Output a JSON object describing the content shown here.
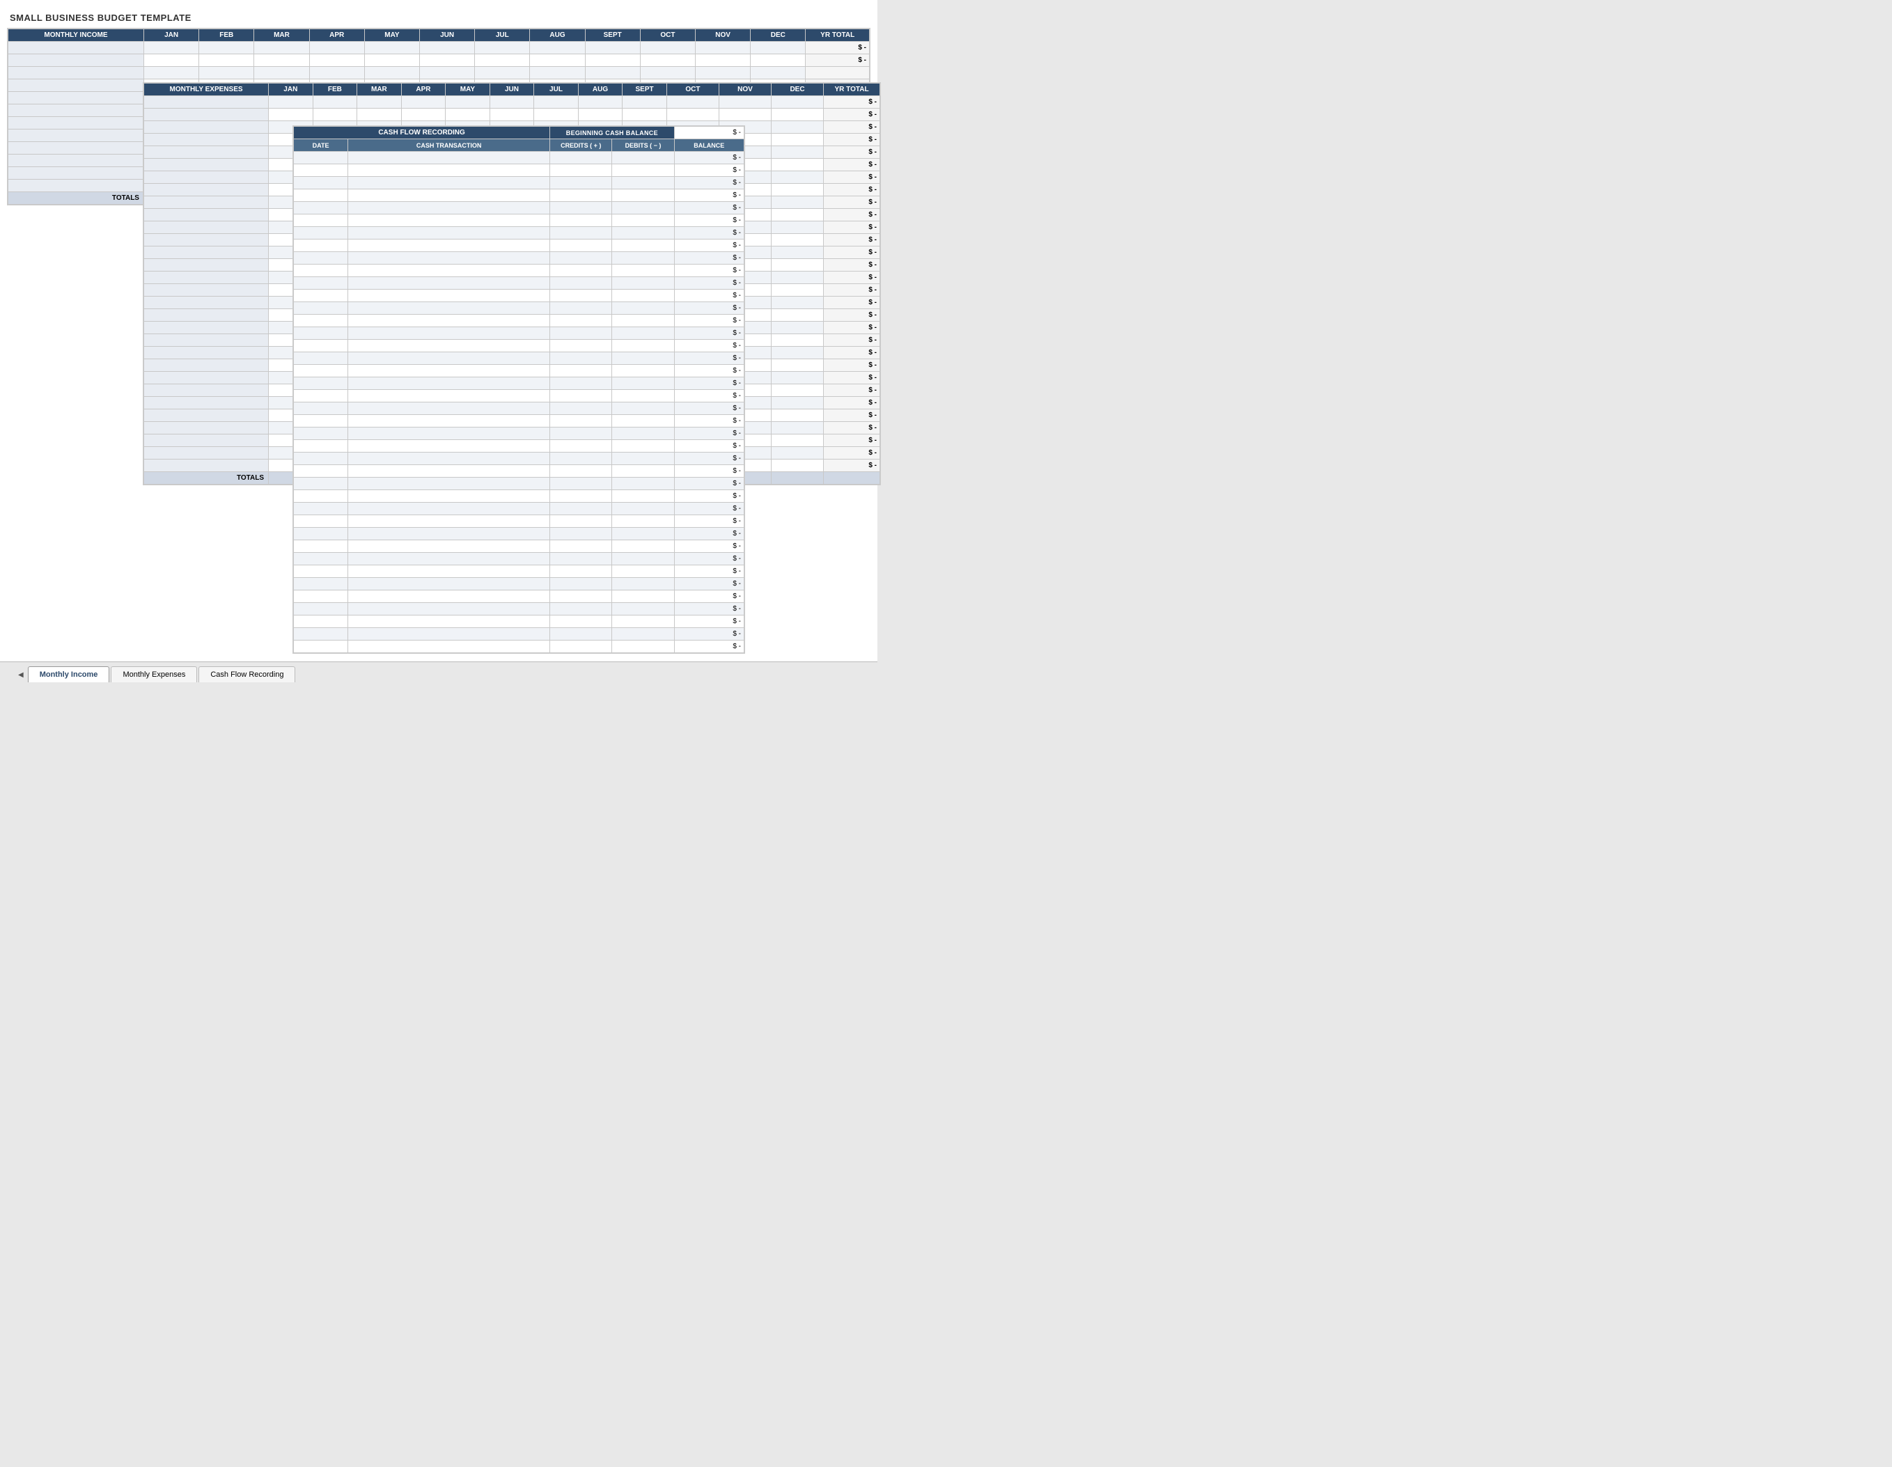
{
  "app": {
    "title": "SMALL BUSINESS BUDGET TEMPLATE"
  },
  "tabs": [
    {
      "label": "Monthly Income",
      "active": true
    },
    {
      "label": "Monthly Expenses",
      "active": false
    },
    {
      "label": "Cash Flow Recording",
      "active": false
    }
  ],
  "income_sheet": {
    "header": "MONTHLY INCOME",
    "months": [
      "JAN",
      "FEB",
      "MAR",
      "APR",
      "MAY",
      "JUN",
      "JUL",
      "AUG",
      "SEPT",
      "OCT",
      "NOV",
      "DEC"
    ],
    "yr_total": "YR TOTAL",
    "dollar": "$",
    "dash": "-",
    "rows": 10,
    "totals_label": "TOTALS"
  },
  "expenses_sheet": {
    "header": "MONTHLY EXPENSES",
    "months": [
      "JAN",
      "FEB",
      "MAR",
      "APR",
      "MAY",
      "JUN",
      "JUL",
      "AUG",
      "SEPT",
      "OCT",
      "NOV",
      "DEC"
    ],
    "yr_total": "YR TOTAL",
    "dollar": "$",
    "dash": "-",
    "rows": 28,
    "totals_label": "TOTALS"
  },
  "cashflow_sheet": {
    "header": "CASH FLOW RECORDING",
    "beginning_cash_label": "BEGINNING CASH BALANCE",
    "beginning_cash_value": "-",
    "dollar": "$",
    "columns": {
      "date": "DATE",
      "transaction": "CASH TRANSACTION",
      "credits": "CREDITS ( + )",
      "debits": "DEBITS ( − )",
      "balance": "BALANCE"
    },
    "rows": 38,
    "dollar_dash": "$ -"
  }
}
